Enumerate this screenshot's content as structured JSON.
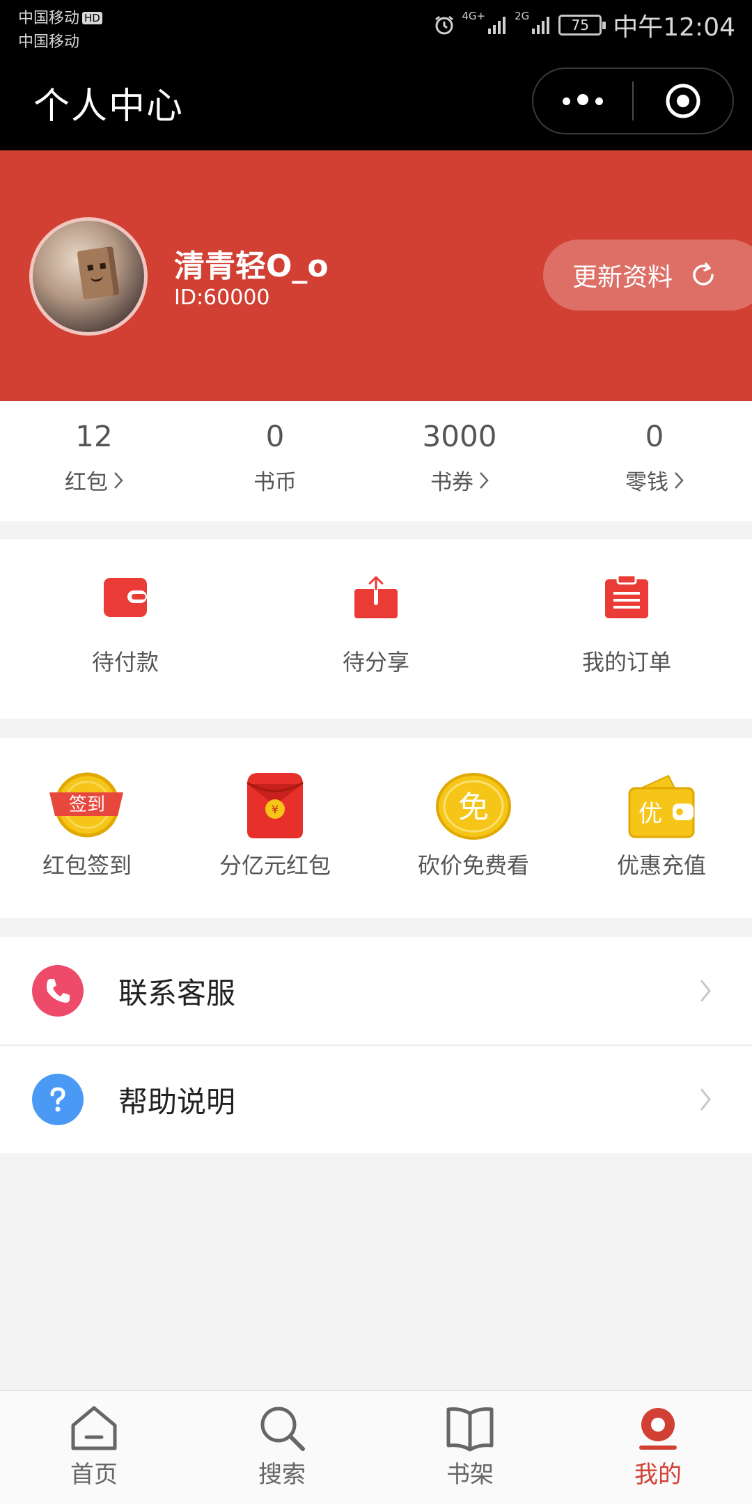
{
  "status_bar": {
    "carrier_1": "中国移动",
    "hd_badge": "HD",
    "carrier_2": "中国移动",
    "network_1": "4G+",
    "network_2": "2G",
    "battery": "75",
    "time": "中午12:04"
  },
  "nav": {
    "title": "个人中心"
  },
  "profile": {
    "username": "清青轻O_o",
    "user_id": "ID:60000",
    "update_label": "更新资料"
  },
  "stats": [
    {
      "value": "12",
      "label": "红包"
    },
    {
      "value": "0",
      "label": "书币"
    },
    {
      "value": "3000",
      "label": "书券"
    },
    {
      "value": "0",
      "label": "零钱"
    }
  ],
  "orders": [
    {
      "label": "待付款",
      "icon": "wallet-icon"
    },
    {
      "label": "待分享",
      "icon": "share-box-icon"
    },
    {
      "label": "我的订单",
      "icon": "order-list-icon"
    }
  ],
  "promos": [
    {
      "label": "红包签到",
      "icon": "checkin-coin-icon",
      "badge": "签到"
    },
    {
      "label": "分亿元红包",
      "icon": "red-envelope-icon",
      "badge": "¥"
    },
    {
      "label": "砍价免费看",
      "icon": "free-coin-icon",
      "badge": "免"
    },
    {
      "label": "优惠充值",
      "icon": "discount-wallet-icon",
      "badge": "优"
    }
  ],
  "menu": [
    {
      "label": "联系客服",
      "icon": "phone-icon",
      "color": "#ee4b6a"
    },
    {
      "label": "帮助说明",
      "icon": "help-icon",
      "color": "#4a9af5"
    }
  ],
  "tabbar": [
    {
      "label": "首页",
      "icon": "home-icon"
    },
    {
      "label": "搜索",
      "icon": "search-icon"
    },
    {
      "label": "书架",
      "icon": "bookshelf-icon"
    },
    {
      "label": "我的",
      "icon": "profile-icon",
      "active": true
    }
  ],
  "colors": {
    "brand_red": "#d23f33",
    "icon_red": "#ea3b36",
    "gold": "#f5c518"
  }
}
